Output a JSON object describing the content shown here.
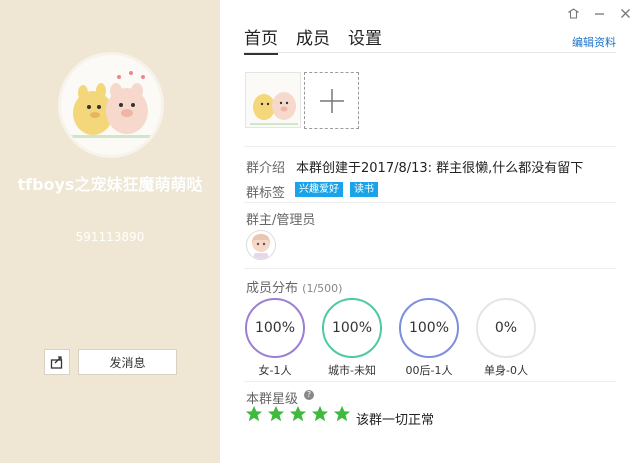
{
  "group": {
    "name": "tfboys之宠妹狂魔萌萌哒",
    "id": "591113890",
    "share_icon": "share-icon",
    "send_message_label": "发消息"
  },
  "window": {
    "controls": [
      "skin-icon",
      "minimize-icon",
      "close-icon"
    ]
  },
  "tabs": [
    {
      "label": "首页",
      "active": true
    },
    {
      "label": "成员",
      "active": false
    },
    {
      "label": "设置",
      "active": false
    }
  ],
  "edit_profile_label": "编辑资料",
  "intro": {
    "label": "群介绍",
    "text": "本群创建于2017/8/13:  群主很懒,什么都没有留下"
  },
  "tags": {
    "label": "群标签",
    "items": [
      "兴趣爱好",
      "读书"
    ],
    "color": "#1aa3e8"
  },
  "admins": {
    "label": "群主/管理员"
  },
  "distribution": {
    "label": "成员分布",
    "count": "(1/500)",
    "items": [
      {
        "percent": "100%",
        "caption": "女-1人",
        "color": "#9b7fd1"
      },
      {
        "percent": "100%",
        "caption": "城市-未知",
        "color": "#4ec9a3"
      },
      {
        "percent": "100%",
        "caption": "00后-1人",
        "color": "#7d8fdc"
      },
      {
        "percent": "0%",
        "caption": "单身-0人",
        "color": "#e5e5e5"
      }
    ]
  },
  "level": {
    "label": "本群星级",
    "stars": 5,
    "status": "该群一切正常",
    "star_color": "#3fba3f"
  }
}
